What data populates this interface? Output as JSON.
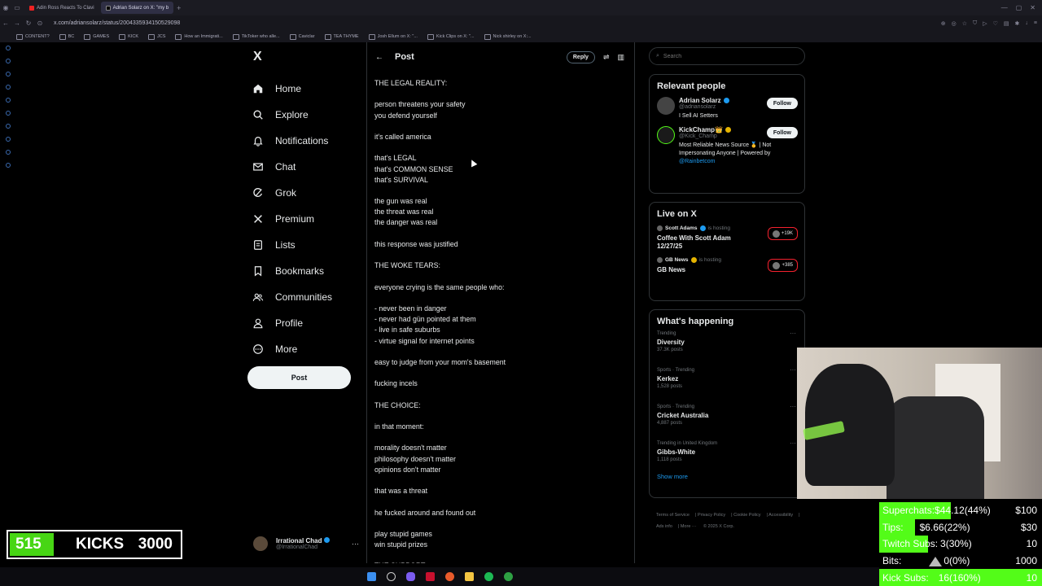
{
  "browser": {
    "tabs": [
      {
        "label": "Adin Ross Reacts To Clavi",
        "active": false
      },
      {
        "label": "Adrian Solarz on X: \"my b",
        "active": true
      }
    ],
    "url": "x.com/adriansolarz/status/2004335934150529098",
    "bookmarks": [
      "CONTENT?",
      "BC",
      "GAMES",
      "KICK",
      "JCS",
      "How an Immigrati...",
      "TikToker who alle...",
      "Caviclar",
      "TEA THYME",
      "Josh Ellum on X: \"...",
      "Kick Clips on X: \"...",
      "Nick shirley on X:..."
    ]
  },
  "sidebar": {
    "logo": "X",
    "items": [
      {
        "label": "Home",
        "icon": "home-icon"
      },
      {
        "label": "Explore",
        "icon": "search-icon"
      },
      {
        "label": "Notifications",
        "icon": "bell-icon"
      },
      {
        "label": "Chat",
        "icon": "mail-icon"
      },
      {
        "label": "Grok",
        "icon": "grok-icon"
      },
      {
        "label": "Premium",
        "icon": "x-premium-icon"
      },
      {
        "label": "Lists",
        "icon": "list-icon"
      },
      {
        "label": "Bookmarks",
        "icon": "bookmark-icon"
      },
      {
        "label": "Communities",
        "icon": "communities-icon"
      },
      {
        "label": "Profile",
        "icon": "person-icon"
      },
      {
        "label": "More",
        "icon": "more-circle-icon"
      }
    ],
    "post_button": "Post",
    "account": {
      "name": "Irrational Chad",
      "handle": "@IrrationalChad"
    }
  },
  "main": {
    "title": "Post",
    "reply_button": "Reply",
    "lines": [
      "THE LEGAL REALITY:",
      "",
      "person threatens your safety",
      "you defend yourself",
      "",
      "it's called america",
      "",
      "that's LEGAL",
      "that's COMMON SENSE",
      "that's SURVIVAL",
      "",
      "the gun was real",
      "the threat was real",
      "the danger was real",
      "",
      "this response was justified",
      "",
      "THE WOKE TEARS:",
      "",
      "everyone crying is the same people who:",
      "",
      "- never been in danger",
      "- never had gün pointed at them",
      "- live in safe suburbs",
      "- virtue signal for internet points",
      "",
      "easy to judge from your mom's basement",
      "",
      "fucking incels",
      "",
      "THE CHOICE:",
      "",
      "in that moment:",
      "",
      "morality doesn't matter",
      "philosophy doesn't matter",
      "opinions don't matter",
      "",
      "that was a threat",
      "",
      "he fucked around and found out",
      "",
      "play stupid games",
      "win stupid prizes",
      "",
      "THE SUPPORT:"
    ]
  },
  "right": {
    "search_placeholder": "Search",
    "relevant_title": "Relevant people",
    "people": [
      {
        "name": "Adrian Solarz",
        "handle": "@adriansolarz",
        "bio": "I Sell AI Setters",
        "bio_link": "",
        "follow": "Follow",
        "badge": "blue"
      },
      {
        "name": "KickChamp👑",
        "handle": "@Kick_Champ",
        "bio": "Most Reliable News Source 🥇 | Not Impersonating Anyone | Powered by ",
        "bio_link": "@Rainbetcom",
        "follow": "Follow",
        "badge": "gold"
      }
    ],
    "live_title": "Live on X",
    "live": [
      {
        "host": "Scott Adams",
        "hosting": "is hosting",
        "title": "Coffee With Scott Adam 12/27/25",
        "count": "+19K"
      },
      {
        "host": "GB News",
        "hosting": "is hosting",
        "title": "GB News",
        "count": "+385"
      }
    ],
    "happening_title": "What's happening",
    "trends": [
      {
        "context": "Trending",
        "name": "Diversity",
        "posts": "37.3K posts"
      },
      {
        "context": "Sports · Trending",
        "name": "Kerkez",
        "posts": "1,528 posts"
      },
      {
        "context": "Sports · Trending",
        "name": "Cricket Australia",
        "posts": "4,887 posts"
      },
      {
        "context": "Trending in United Kingdom",
        "name": "Gibbs-White",
        "posts": "1,118 posts"
      }
    ],
    "show_more": "Show more",
    "footer": [
      "Terms of Service",
      "Privacy Policy",
      "Cookie Policy",
      "Accessibility",
      "Ads info",
      "More ···",
      "© 2025 X Corp."
    ]
  },
  "stream": {
    "kicks": {
      "current": "515",
      "label": "KICKS",
      "goal": "3000",
      "progress": 0.17
    },
    "stats": [
      {
        "label": "Superchats:",
        "value": "$44.12(44%)",
        "goal": "$100",
        "progress": 0.44
      },
      {
        "label": "Tips:",
        "value": "$6.66(22%)",
        "goal": "$30",
        "progress": 0.22
      },
      {
        "label": "Twitch Subs:",
        "value": "3(30%)",
        "goal": "10",
        "progress": 0.3
      },
      {
        "label": "Bits:",
        "value": "0(0%)",
        "goal": "1000",
        "progress": 0.0
      },
      {
        "label": "Kick Subs:",
        "value": "16(160%)",
        "goal": "10",
        "progress": 1.0
      }
    ]
  },
  "colors": {
    "kick_green": "#53fc18",
    "x_blue": "#1d9bf0",
    "border": "#2f3336"
  }
}
